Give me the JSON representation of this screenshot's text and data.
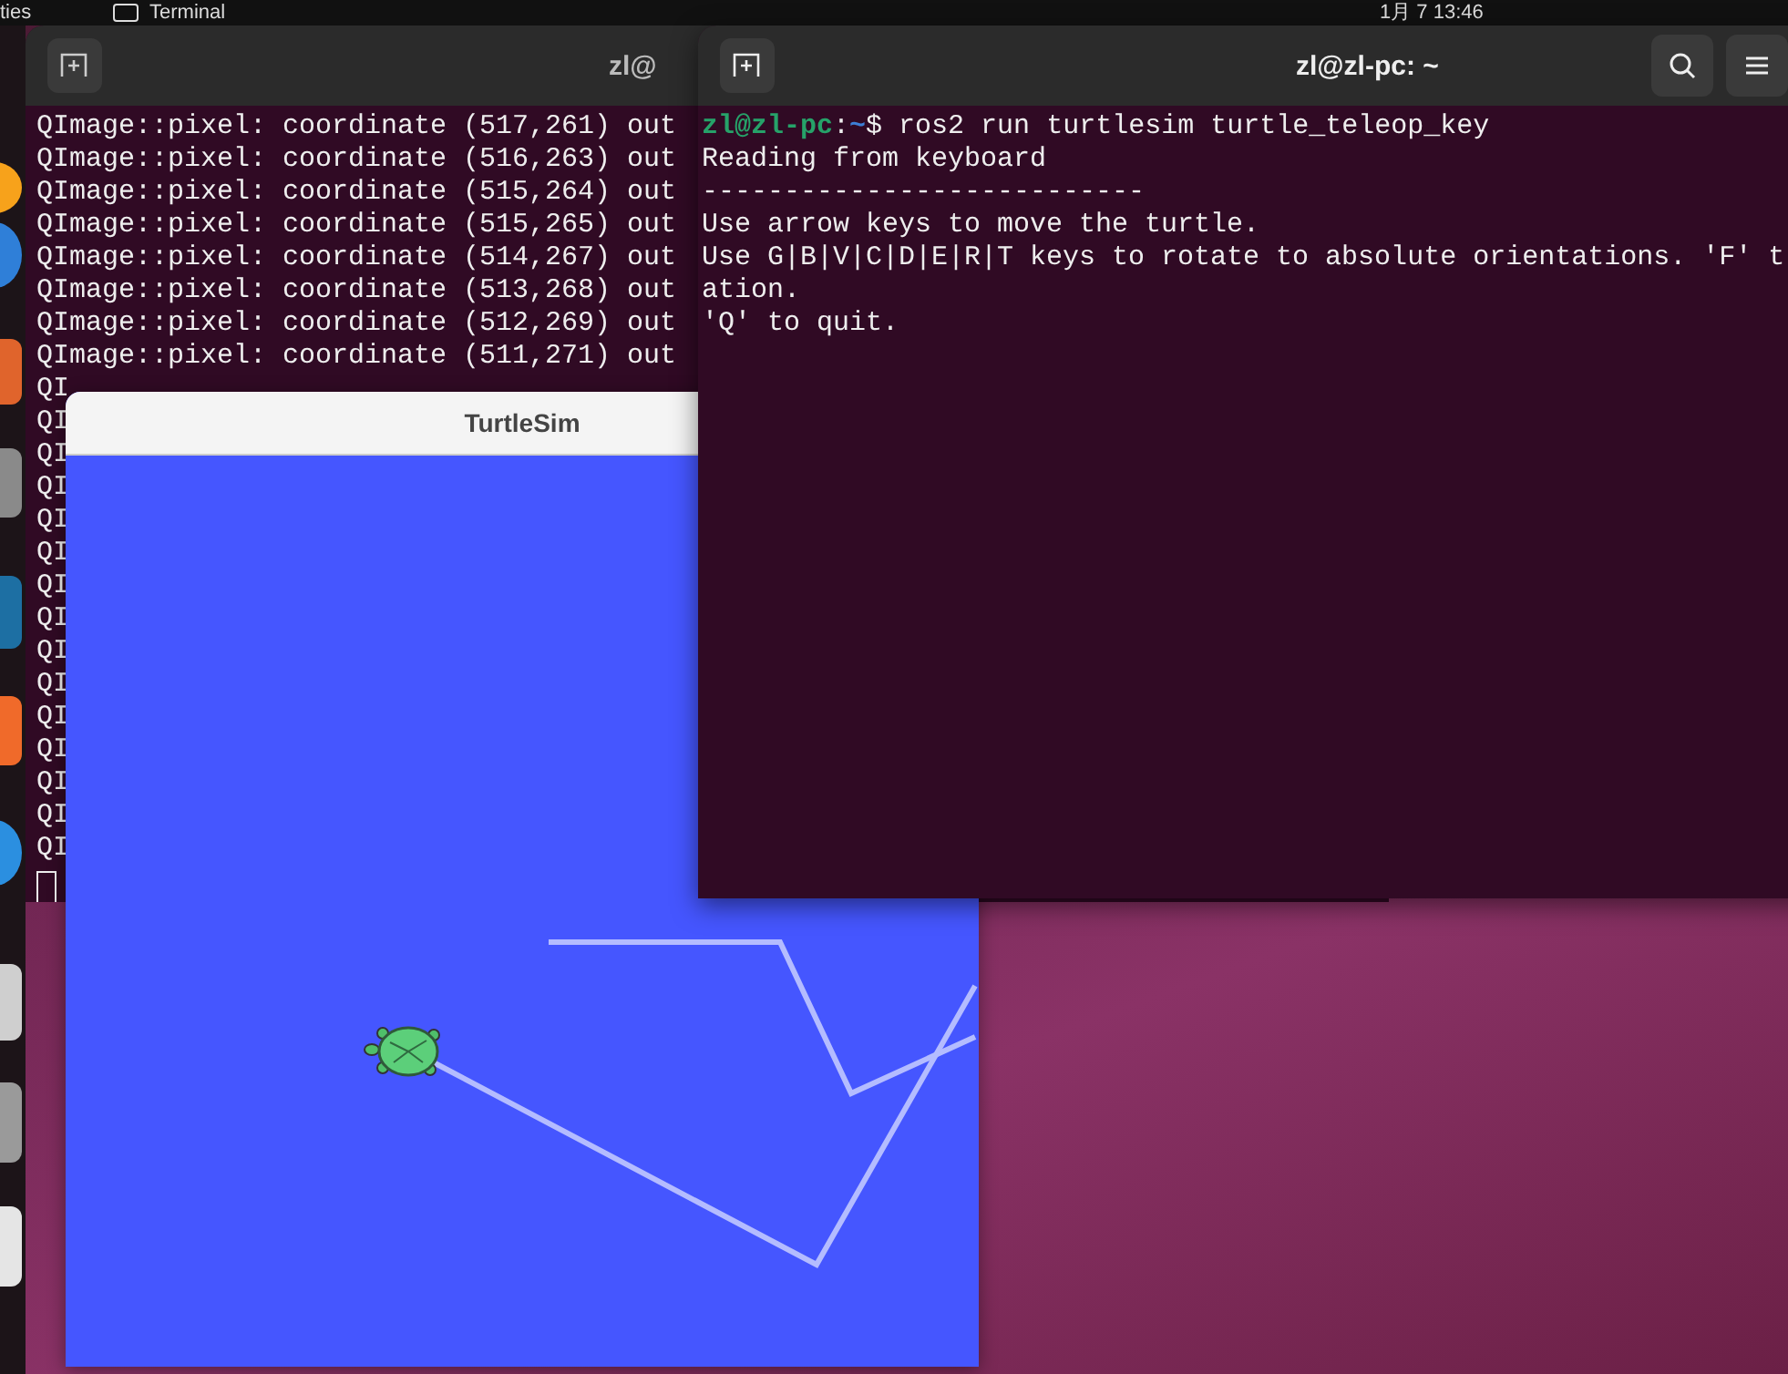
{
  "top_bar": {
    "activities": "ties",
    "app_menu": "Terminal",
    "clock": "1月 7  13:46"
  },
  "back_terminal": {
    "title": "zl@",
    "lines": [
      "QImage::pixel: coordinate (517,261) out",
      "QImage::pixel: coordinate (516,263) out",
      "QImage::pixel: coordinate (515,264) out",
      "QImage::pixel: coordinate (515,265) out",
      "QImage::pixel: coordinate (514,267) out",
      "QImage::pixel: coordinate (513,268) out",
      "QImage::pixel: coordinate (512,269) out",
      "QImage::pixel: coordinate (511,271) out",
      "QI",
      "QI",
      "QI",
      "QI",
      "QI",
      "QI",
      "QI",
      "QI",
      "QI",
      "QI",
      "QI",
      "QI",
      "QI",
      "QI",
      "QI"
    ]
  },
  "turtlesim": {
    "title": "TurtleSim"
  },
  "front_terminal": {
    "title": "zl@zl-pc: ~",
    "prompt": {
      "user": "zl@zl-pc",
      "sep": ":",
      "path": "~",
      "symbol": "$",
      "command": " ros2 run turtlesim turtle_teleop_key"
    },
    "lines": [
      "Reading from keyboard",
      "---------------------------",
      "Use arrow keys to move the turtle.",
      "Use G|B|V|C|D|E|R|T keys to rotate to absolute orientations. 'F' t",
      "ation.",
      "'Q' to quit."
    ]
  }
}
